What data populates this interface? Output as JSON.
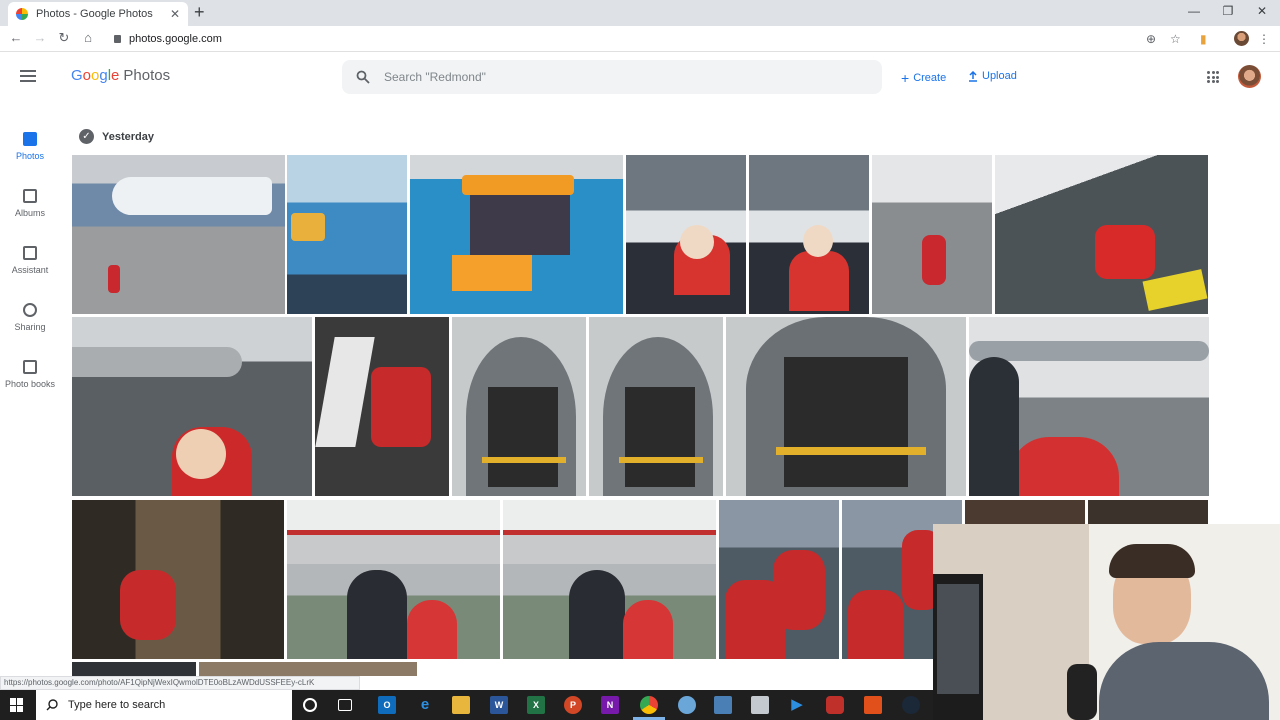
{
  "browser": {
    "tab_title": "Photos - Google Photos",
    "tab_close": "✕",
    "new_tab": "+",
    "url": "photos.google.com",
    "window_controls": [
      "—",
      "❐",
      "✕"
    ]
  },
  "header": {
    "logo_letters": [
      "G",
      "o",
      "o",
      "g",
      "l",
      "e"
    ],
    "logo_product": "Photos",
    "search_placeholder": "Search \"Redmond\"",
    "create_label": "Create",
    "upload_label": "Upload"
  },
  "sidebar": {
    "items": [
      {
        "label": "Photos",
        "icon": "photo-icon",
        "active": true
      },
      {
        "label": "Albums",
        "icon": "album-icon",
        "active": false
      },
      {
        "label": "Assistant",
        "icon": "assistant-icon",
        "active": false
      },
      {
        "label": "Sharing",
        "icon": "people-icon",
        "active": false
      },
      {
        "label": "Photo books",
        "icon": "book-icon",
        "active": false
      }
    ]
  },
  "section": {
    "date_label": "Yesterday"
  },
  "status_bar": {
    "hover_url": "https://photos.google.com/photo/AF1QipNjWexIQwmolDTE0oBLzAWDdUSSFEEy-cLrK"
  },
  "taskbar": {
    "search_text": "Type here to search",
    "apps": [
      "cortana",
      "task-view",
      "outlook",
      "edge",
      "file-explorer",
      "word",
      "excel",
      "powerpoint",
      "onenote",
      "chrome",
      "photos",
      "store",
      "remote",
      "media",
      "camera",
      "office",
      "steam"
    ]
  },
  "colors": {
    "accent": "#1a73e8",
    "rail_icon": "#5f6368"
  }
}
